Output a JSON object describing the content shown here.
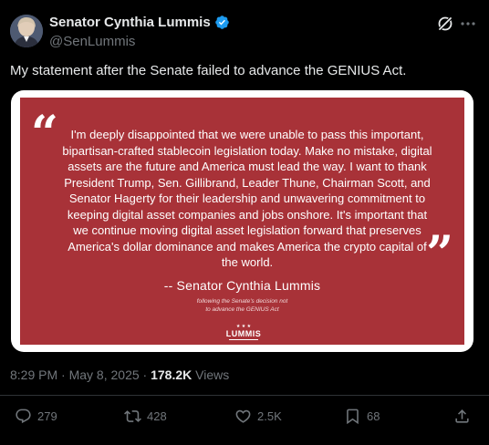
{
  "author": {
    "display_name": "Senator Cynthia Lummis",
    "handle": "@SenLummis"
  },
  "tweet": {
    "text": "My statement after the Senate failed to advance the GENIUS Act."
  },
  "image_card": {
    "background_color": "#a83238",
    "quote_open": "“",
    "quote_close": "”",
    "statement": "I'm deeply disappointed that we were unable to pass this important, bipartisan-crafted stablecoin legislation today. Make no mistake, digital assets are the future and America must lead the way. I want to thank President Trump, Sen. Gillibrand, Leader Thune, Chairman Scott, and Senator Hagerty for their leadership and unwavering commitment to keeping digital asset companies and jobs onshore. It's important that we continue moving digital asset legislation forward that preserves America's dollar dominance and makes America the crypto capital of the world.",
    "signature": "-- Senator Cynthia Lummis",
    "signature_subtitle": "following the Senate's decision not to advance the GENIUS Act",
    "logo_text": "LUMMIS",
    "logo_stars": "★ ★ ★"
  },
  "meta": {
    "time": "8:29 PM",
    "separator": "·",
    "date": "May 8, 2025",
    "views_count": "178.2K",
    "views_label": "Views"
  },
  "actions": {
    "replies": "279",
    "reposts": "428",
    "likes": "2.5K",
    "bookmarks": "68"
  },
  "icons": {
    "verified": "verified-badge-icon",
    "grok": "grok-icon",
    "more": "more-icon",
    "reply": "reply-icon",
    "repost": "repost-icon",
    "like": "heart-icon",
    "bookmark": "bookmark-icon",
    "share": "share-icon"
  },
  "colors": {
    "verified": "#1d9bf0",
    "muted_text": "#71767b",
    "primary_text": "#e7e9ea"
  }
}
